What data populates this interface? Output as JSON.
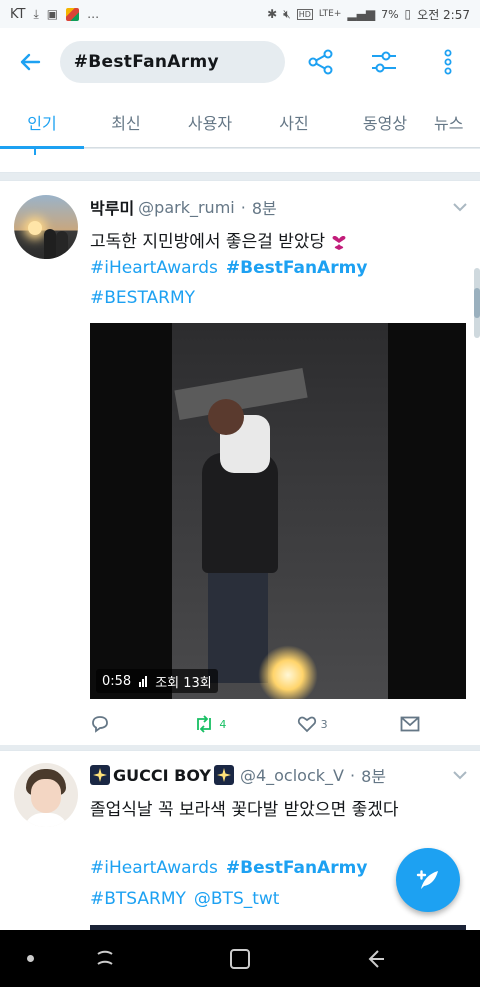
{
  "statusbar": {
    "carrier": "KT",
    "battery": "7%",
    "time_label": "오전 2:57",
    "network": "LTE+"
  },
  "header": {
    "search_query": "#BestFanArmy"
  },
  "tabs": [
    {
      "label": "인기",
      "active": true
    },
    {
      "label": "최신",
      "active": false
    },
    {
      "label": "사용자",
      "active": false
    },
    {
      "label": "사진",
      "active": false
    },
    {
      "label": "동영상",
      "active": false
    },
    {
      "label": "뉴스",
      "active": false
    }
  ],
  "tweets": [
    {
      "name": "박루미",
      "handle": "@park_rumi",
      "dot": "·",
      "time": "8분",
      "text": "고독한 지민방에서 좋은걸 받았당",
      "hashtags_line1": [
        "#iHeartAwards",
        "#BestFanArmy"
      ],
      "hashtags_line2": [
        "#BESTARMY"
      ],
      "video": {
        "duration": "0:58",
        "views": "조회 13회"
      },
      "actions": {
        "reply_count": "",
        "retweet_count": "4",
        "like_count": "3"
      }
    },
    {
      "name": "GUCCI BOY",
      "handle": "@4_oclock_V",
      "dot": "·",
      "time": "8분",
      "text": "졸업식날 꼭 보라색 꽃다발 받았으면 좋겠다",
      "hashtags_line1": [
        "#iHeartAwards",
        "#BestFanArmy"
      ],
      "hashtags_line2": [
        "#BTSARMY",
        "@BTS_twt"
      ]
    }
  ],
  "colors": {
    "accent": "#1da1f2",
    "retweet_green": "#17bf63",
    "secondary_text": "#657786",
    "background": "#e6ecf0"
  },
  "icons": {
    "back": "arrow-left-icon",
    "share": "share-icon",
    "filter": "sliders-icon",
    "more": "more-vertical-icon",
    "compose": "compose-feather-icon"
  }
}
